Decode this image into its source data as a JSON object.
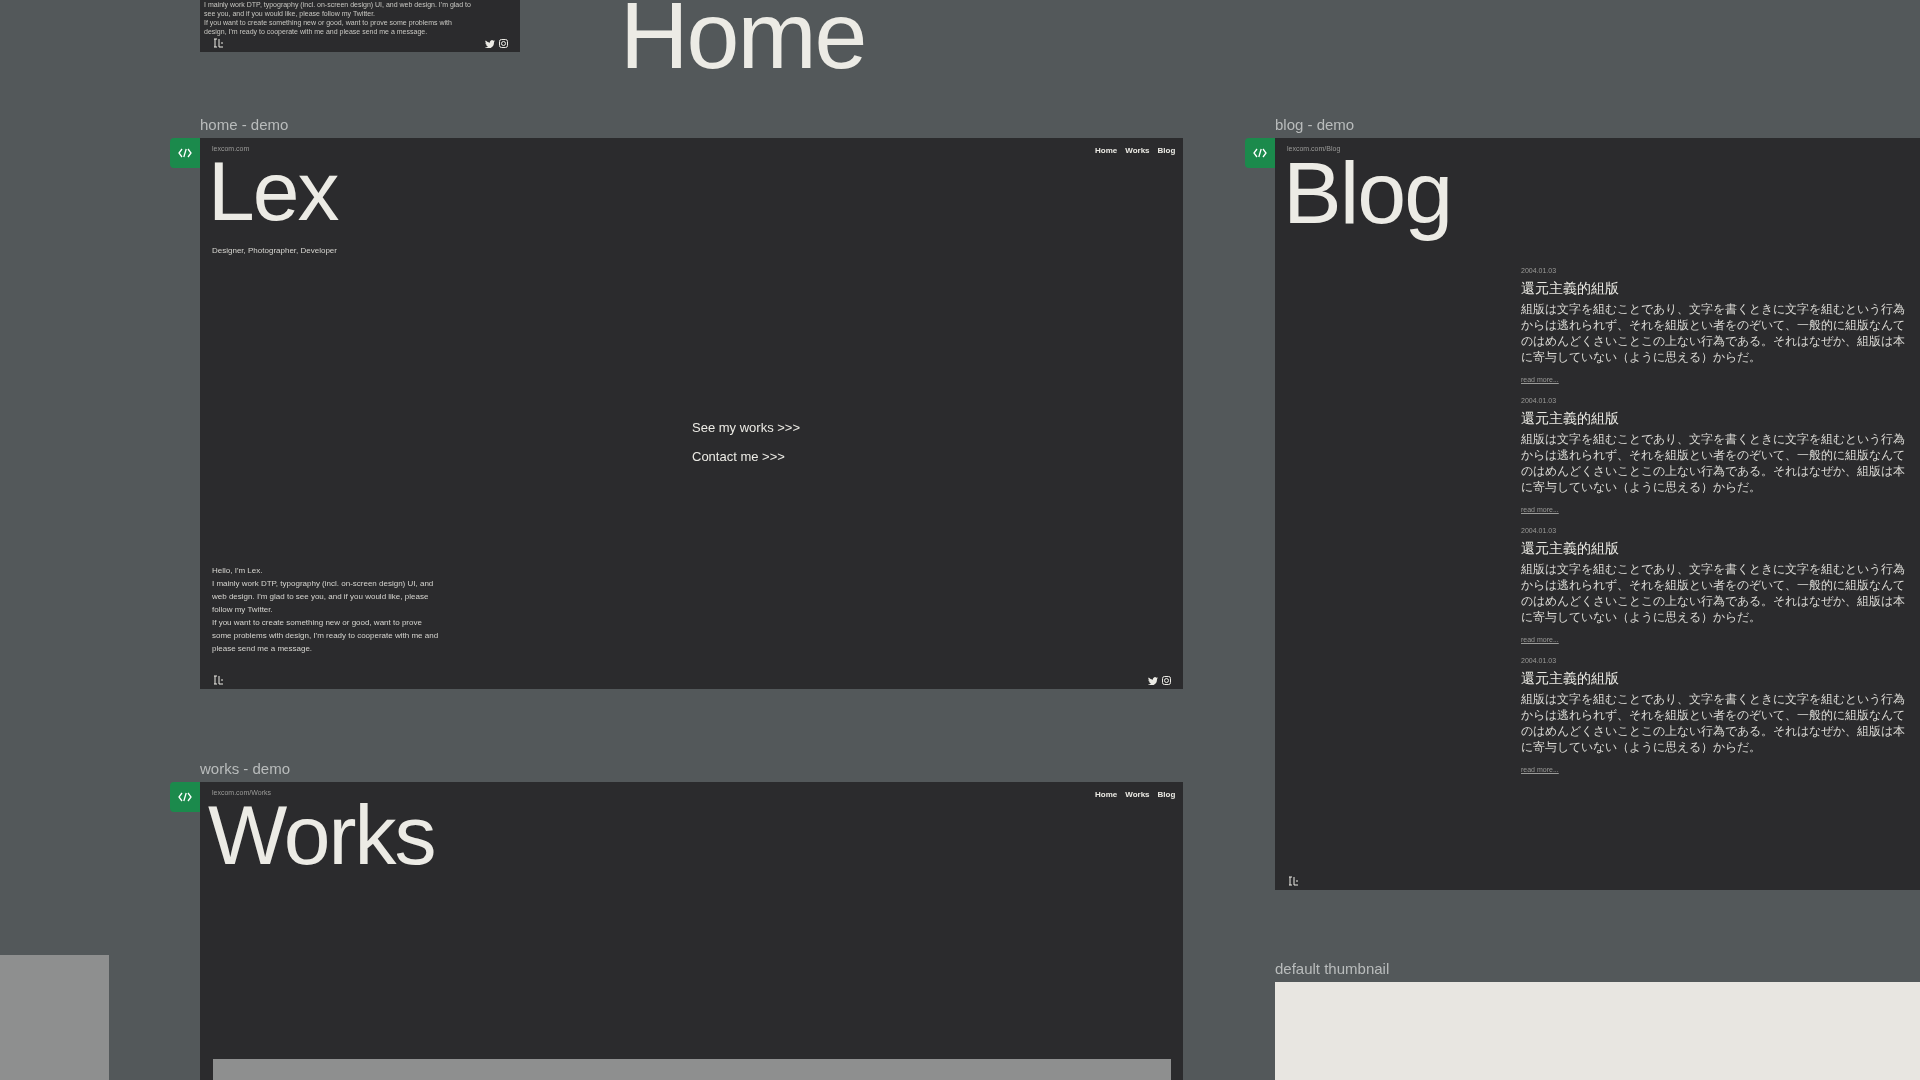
{
  "canvas_title": "Home",
  "partial_frame": {
    "lines": [
      "I mainly work DTP, typography (incl. on-screen design) UI, and web design. I'm glad to",
      "see you, and if you would like, please follow my Twitter.",
      "If you want to create something new or good, want to prove some problems with",
      "design, I'm ready to cooperate with me and please send me a message."
    ]
  },
  "frames": [
    {
      "kind": "home",
      "label": "home - demo",
      "url": "lexcom.com",
      "heading": "Lex",
      "nav": [
        "Home",
        "Works",
        "Blog"
      ],
      "subtitle": "Designer, Photographer, Developer",
      "links": [
        "See my works >>>",
        "Contact me >>>"
      ],
      "bio": [
        "Hello, I'm Lex.",
        "I mainly work DTP, typography (incl. on-screen design) UI, and",
        "web design. I'm glad to see you, and if you would like, please",
        "follow my Twitter.",
        "If you want to create something new or good, want to prove",
        "some problems with design, I'm ready to cooperate with me and",
        "please send me a message."
      ]
    },
    {
      "kind": "blog",
      "label": "blog - demo",
      "url": "lexcom.com/Blog",
      "heading": "Blog",
      "posts": [
        {
          "date": "2004.01.03",
          "title": "還元主義的組版",
          "body": "組版は文字を組むことであり、文字を書くときに文字を組むという行為からは逃れられず、それを組版とい者をのぞいて、一般的に組版なんてのはめんどくさいことこの上ない行為である。それはなぜか、組版は本に寄与していない（ように思える）からだ。",
          "more": "read more..."
        },
        {
          "date": "2004.01.03",
          "title": "還元主義的組版",
          "body": "組版は文字を組むことであり、文字を書くときに文字を組むという行為からは逃れられず、それを組版とい者をのぞいて、一般的に組版なんてのはめんどくさいことこの上ない行為である。それはなぜか、組版は本に寄与していない（ように思える）からだ。",
          "more": "read more..."
        },
        {
          "date": "2004.01.03",
          "title": "還元主義的組版",
          "body": "組版は文字を組むことであり、文字を書くときに文字を組むという行為からは逃れられず、それを組版とい者をのぞいて、一般的に組版なんてのはめんどくさいことこの上ない行為である。それはなぜか、組版は本に寄与していない（ように思える）からだ。",
          "more": "read more..."
        },
        {
          "date": "2004.01.03",
          "title": "還元主義的組版",
          "body": "組版は文字を組むことであり、文字を書くときに文字を組むという行為からは逃れられず、それを組版とい者をのぞいて、一般的に組版なんてのはめんどくさいことこの上ない行為である。それはなぜか、組版は本に寄与していない（ように思える）からだ。",
          "more": "read more..."
        }
      ]
    },
    {
      "kind": "works",
      "label": "works - demo",
      "url": "lexcom.com/Works",
      "heading": "Works",
      "nav": [
        "Home",
        "Works",
        "Blog"
      ]
    },
    {
      "kind": "thumbnail",
      "label": "default thumbnail"
    }
  ]
}
